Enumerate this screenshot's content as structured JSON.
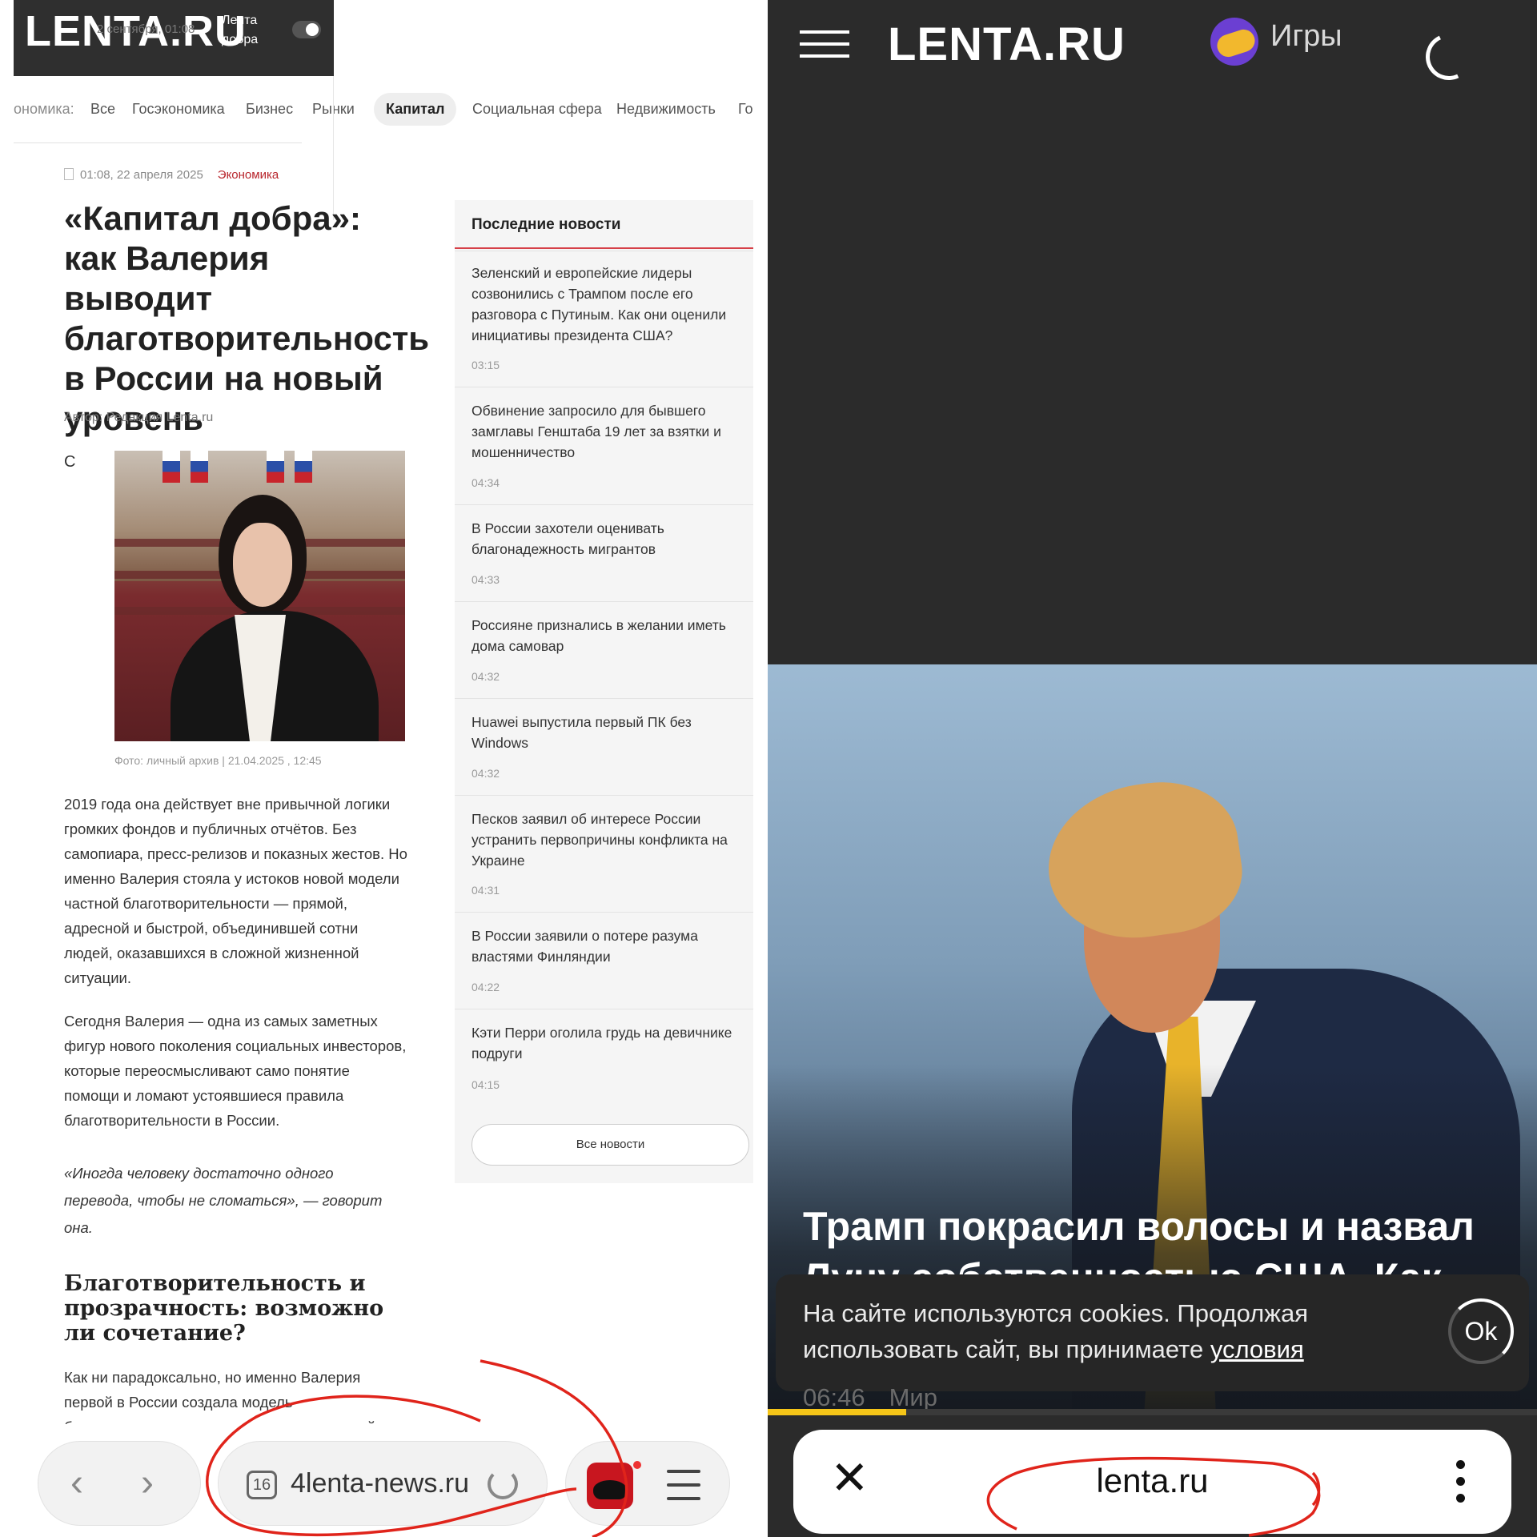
{
  "left": {
    "header": {
      "logo": "LENTA.RU",
      "date_ghost": "2 сентября, 01:08",
      "tag": "Лента добра"
    },
    "categories": {
      "prefix": "ономика:",
      "items": [
        "Все",
        "Госэкономика",
        "Бизнес",
        "Рынки",
        "Капитал",
        "Социальная сфера",
        "Недвижимость",
        "Го"
      ],
      "active": "Капитал"
    },
    "article": {
      "datetime": "01:08, 22 апреля 2025",
      "rubric": "Экономика",
      "title": "«Капитал добра»: как Валерия выводит благотворительность в России на новый уровень",
      "author": "Автор: Редакция Lenta.ru",
      "dropcap": "С",
      "photo_caption": "Фото: личный архив | 21.04.2025 , 12:45",
      "para1": "2019 года она действует вне привычной логики громких фондов и публичных отчётов. Без самопиара, пресс-релизов и показных жестов. Но именно Валерия стояла у истоков новой модели частной благотворительности — прямой, адресной и быстрой, объединившей сотни людей, оказавшихся в сложной жизненной ситуации.",
      "para2": "Сегодня Валерия — одна из самых заметных фигур нового поколения социальных инвесторов, которые переосмысливают само понятие помощи и ломают устоявшиеся правила благотворительности в России.",
      "quote": "«Иногда человеку достаточно одного перевода, чтобы не сломаться», — говорит она.",
      "subhead": "Благотворительность и прозрачность: возможно ли сочетание?",
      "para3": "Как ни парадоксально, но именно Валерия первой в России создала модель благотворительности, основанную на полной"
    },
    "sidebar": {
      "heading": "Последние новости",
      "items": [
        {
          "title": "Зеленский и европейские лидеры созвонились с Трампом после его разговора с Путиным. Как они оценили инициативы президента США?",
          "time": "03:15"
        },
        {
          "title": "Обвинение запросило для бывшего замглавы Генштаба 19 лет за взятки и мошенничество",
          "time": "04:34"
        },
        {
          "title": "В России захотели оценивать благонадежность мигрантов",
          "time": "04:33"
        },
        {
          "title": "Россияне признались в желании иметь дома самовар",
          "time": "04:32"
        },
        {
          "title": "Huawei выпустила первый ПК без Windows",
          "time": "04:32"
        },
        {
          "title": "Песков заявил об интересе России устранить первопричины конфликта на Украине",
          "time": "04:31"
        },
        {
          "title": "В России заявили о потере разума властями Финляндии",
          "time": "04:22"
        },
        {
          "title": "Кэти Перри оголила грудь на девичнике подруги",
          "time": "04:15"
        }
      ],
      "all_news": "Все новости"
    },
    "browser_bar": {
      "back_icon": "‹",
      "forward_icon": "›",
      "tab_count": "16",
      "url": "4lenta-news.ru",
      "app_icon": "app-icon",
      "menu_icon": "menu-icon"
    }
  },
  "right": {
    "header": {
      "logo": "LENTA.RU",
      "games": "Игры"
    },
    "hero": {
      "title": "Трамп покрасил волосы и назвал Луну собственностью США. Как",
      "time": "06:46",
      "rubric": "Мир",
      "progress": 0.18
    },
    "cookie": {
      "text": "На сайте используются cookies. Продолжая использовать сайт, вы принимаете",
      "link": "условия",
      "ok": "Ok"
    },
    "browser_bar": {
      "close_icon": "✕",
      "url": "lenta.ru"
    }
  },
  "colors": {
    "accent_red": "#d64048",
    "rubric_red": "#b8252c",
    "annotation_red": "#e0241b",
    "progress_yellow": "#f5c518"
  }
}
